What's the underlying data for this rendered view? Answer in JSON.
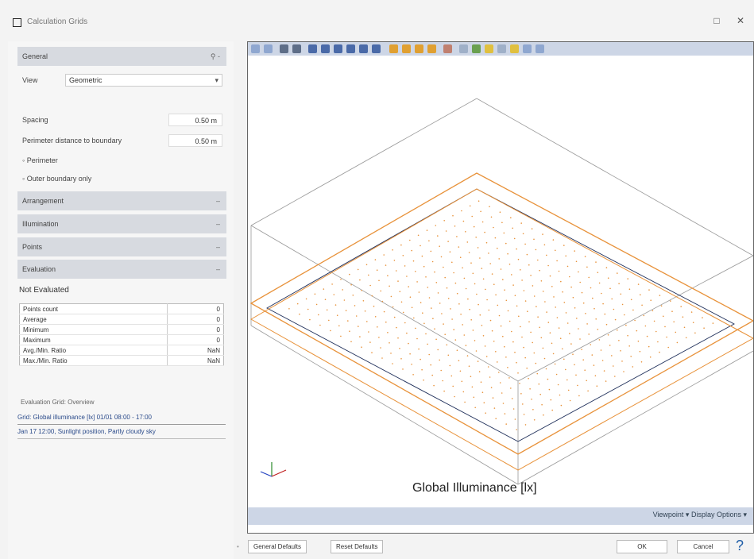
{
  "window": {
    "title": "Calculation Grids",
    "maximize_icon": "□",
    "close_icon": "✕"
  },
  "left_panel": {
    "general": {
      "label": "General",
      "icon_text": "⚲ -"
    },
    "view": {
      "label": "View",
      "value": "Geometric"
    },
    "spacing": {
      "label": "Spacing",
      "value": "0.50 m"
    },
    "distance": {
      "label": "Perimeter distance to boundary",
      "value": "0.50 m"
    },
    "checkboxes": [
      "Perimeter",
      "Outer boundary only"
    ],
    "sections": [
      "Arrangement",
      "Illumination",
      "Points",
      "Evaluation"
    ],
    "not_evaluated": "Not Evaluated",
    "stats": [
      {
        "label": "Points count",
        "value": "0"
      },
      {
        "label": "Average",
        "value": "0"
      },
      {
        "label": "Minimum",
        "value": "0"
      },
      {
        "label": "Maximum",
        "value": "0"
      },
      {
        "label": "Avg./Min. Ratio",
        "value": "NaN"
      },
      {
        "label": "Max./Min. Ratio",
        "value": "NaN"
      }
    ],
    "footnote_1": "Evaluation Grid: Overview",
    "footnote_2": "Grid: Global illuminance [lx] 01/01 08:00 - 17:00",
    "footnote_3": "Jan 17 12:00, Sunlight position, Partly cloudy sky"
  },
  "viewer": {
    "plot_title": "Global Illuminance [lx]",
    "status": "Viewpoint ▾  Display Options ▾"
  },
  "buttons": {
    "general_defaults": "General Defaults",
    "reset_defaults": "Reset Defaults",
    "ok": "OK",
    "cancel": "Cancel",
    "help": "?"
  }
}
